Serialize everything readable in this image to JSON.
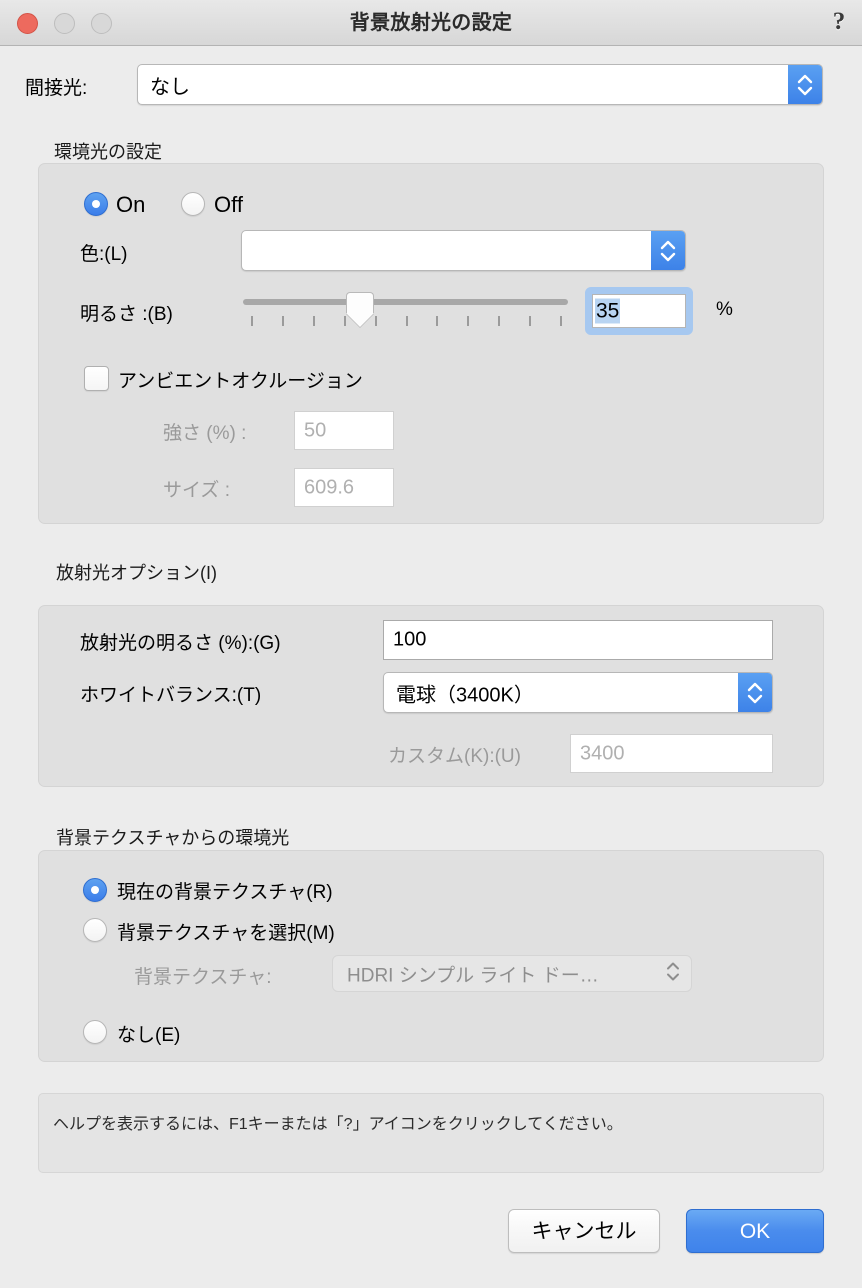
{
  "window": {
    "title": "背景放射光の設定",
    "help_icon": "question-mark-icon",
    "traffic_lights": [
      "close",
      "minimize",
      "zoom"
    ]
  },
  "indirect_light": {
    "label": "間接光:",
    "value": "なし"
  },
  "ambient": {
    "group_title": "環境光の設定",
    "on_label": "On",
    "off_label": "Off",
    "selected": "On",
    "color_label": "色:(L)",
    "color_value": "",
    "color_swatch_hex": "#ffffff",
    "brightness_label": "明るさ :(B)",
    "brightness_value": "35",
    "brightness_unit": "%",
    "brightness_slider_percent": 35,
    "slider_tick_count": 11,
    "occlusion_label": "アンビエントオクルージョン",
    "occlusion_checked": false,
    "strength_label": "強さ (%) :",
    "strength_value": "50",
    "size_label": "サイズ :",
    "size_value": "609.6"
  },
  "emission": {
    "group_title": "放射光オプション(I)",
    "brightness_label": "放射光の明るさ (%):(G)",
    "brightness_value": "100",
    "white_balance_label": "ホワイトバランス:(T)",
    "white_balance_value": "電球（3400K）",
    "custom_label": "カスタム(K):(U)",
    "custom_value": "3400"
  },
  "bg_texture": {
    "group_title": "背景テクスチャからの環境光",
    "options": [
      {
        "label": "現在の背景テクスチャ(R)",
        "selected": true
      },
      {
        "label": "背景テクスチャを選択(M)",
        "selected": false
      },
      {
        "label": "なし(E)",
        "selected": false
      }
    ],
    "texture_label": "背景テクスチャ:",
    "texture_value": "HDRI シンプル ライト ドー…"
  },
  "help": {
    "text": "ヘルプを表示するには、F1キーまたは「?」アイコンをクリックしてください。"
  },
  "footer": {
    "cancel_label": "キャンセル",
    "ok_label": "OK"
  },
  "colors": {
    "accent_blue": "#3b7dea",
    "dialog_bg": "#ececec",
    "group_bg": "#e0e0e0",
    "close_red": "#ed6a5e"
  }
}
